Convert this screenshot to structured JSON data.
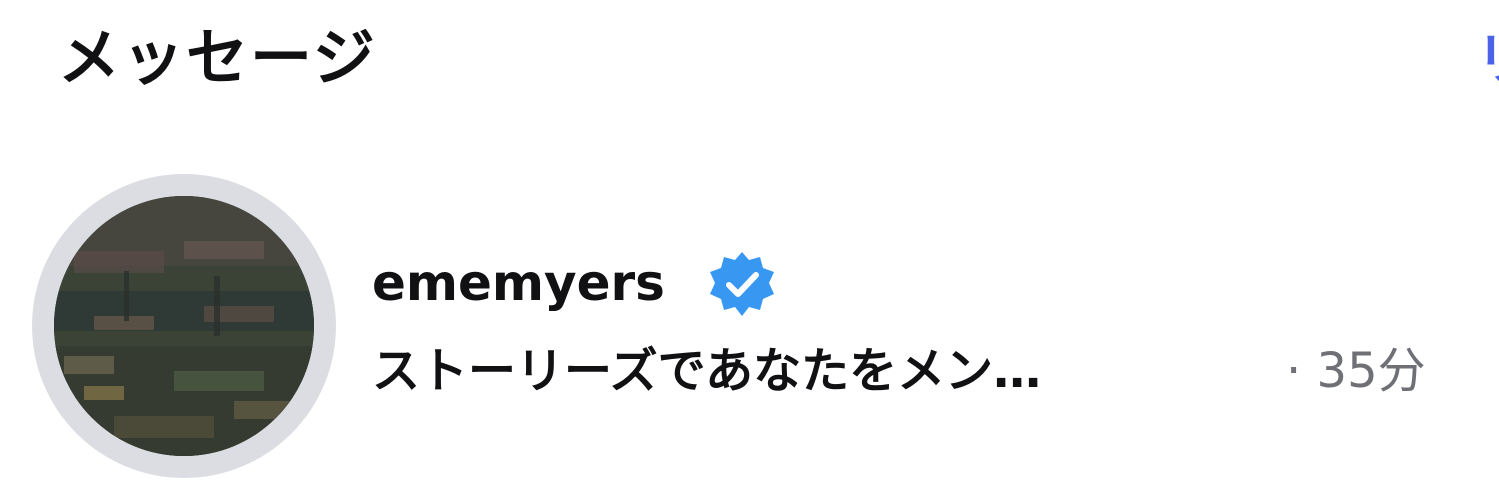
{
  "header": {
    "title": "メッセージ",
    "requests_label": "リ"
  },
  "thread": {
    "avatar_icon": "profile-photo-painting",
    "username": "ememyers",
    "verified_icon": "verified-badge-icon",
    "verified_color": "#3897f0",
    "preview": "ストーリーズであなたをメン…",
    "separator": "·",
    "time": "35分"
  },
  "colors": {
    "text": "#111114",
    "muted": "#6f7075",
    "link": "#4a63e8",
    "ring": "#dcdde3"
  }
}
